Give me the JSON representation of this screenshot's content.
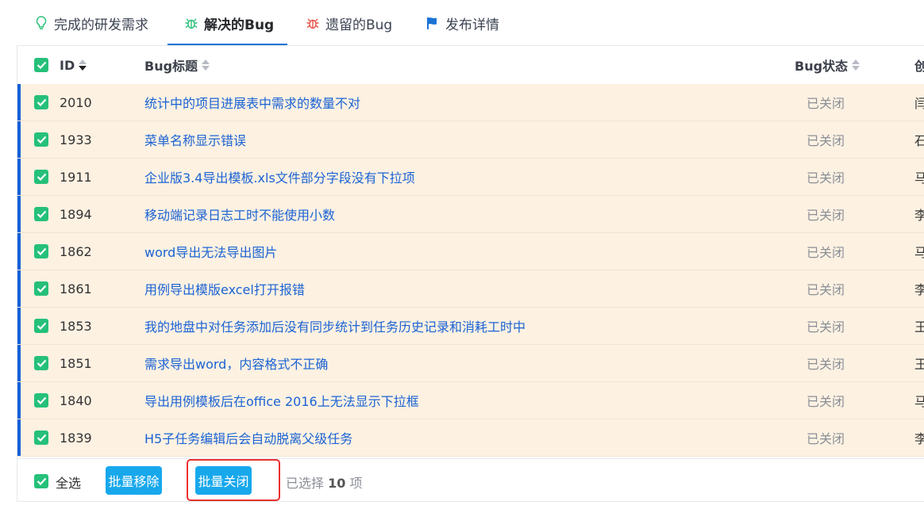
{
  "tabs": [
    {
      "label": "完成的研发需求",
      "icon": "lightbulb-icon",
      "active": false
    },
    {
      "label": "解决的Bug",
      "icon": "bug-icon",
      "active": true
    },
    {
      "label": "遗留的Bug",
      "icon": "bug-icon",
      "active": false
    },
    {
      "label": "发布详情",
      "icon": "flag-icon",
      "active": false
    }
  ],
  "table": {
    "columns": {
      "id": "ID",
      "title": "Bug标题",
      "status": "Bug状态",
      "creator": "创"
    },
    "rows": [
      {
        "id": "2010",
        "title": "统计中的项目进展表中需求的数量不对",
        "status": "已关闭",
        "creator": "闫"
      },
      {
        "id": "1933",
        "title": "菜单名称显示错误",
        "status": "已关闭",
        "creator": "石"
      },
      {
        "id": "1911",
        "title": "企业版3.4导出模板.xls文件部分字段没有下拉项",
        "status": "已关闭",
        "creator": "马"
      },
      {
        "id": "1894",
        "title": "移动端记录日志工时不能使用小数",
        "status": "已关闭",
        "creator": "李"
      },
      {
        "id": "1862",
        "title": "word导出无法导出图片",
        "status": "已关闭",
        "creator": "马"
      },
      {
        "id": "1861",
        "title": "用例导出模版excel打开报错",
        "status": "已关闭",
        "creator": "李"
      },
      {
        "id": "1853",
        "title": "我的地盘中对任务添加后没有同步统计到任务历史记录和消耗工时中",
        "status": "已关闭",
        "creator": "王"
      },
      {
        "id": "1851",
        "title": "需求导出word，内容格式不正确",
        "status": "已关闭",
        "creator": "王"
      },
      {
        "id": "1840",
        "title": "导出用例模板后在office 2016上无法显示下拉框",
        "status": "已关闭",
        "creator": "马"
      },
      {
        "id": "1839",
        "title": "H5子任务编辑后会自动脱离父级任务",
        "status": "已关闭",
        "creator": "李"
      }
    ]
  },
  "footer": {
    "select_all_label": "全选",
    "batch_remove_label": "批量移除",
    "batch_close_label": "批量关闭",
    "selected_prefix": "已选择",
    "selected_count": "10",
    "selected_suffix": "项"
  },
  "colors": {
    "accent": "#1a73d6",
    "checkbox": "#25c07a",
    "button": "#17a8ec",
    "row_bg": "#fdf1e2",
    "highlight": "#e8322c"
  }
}
